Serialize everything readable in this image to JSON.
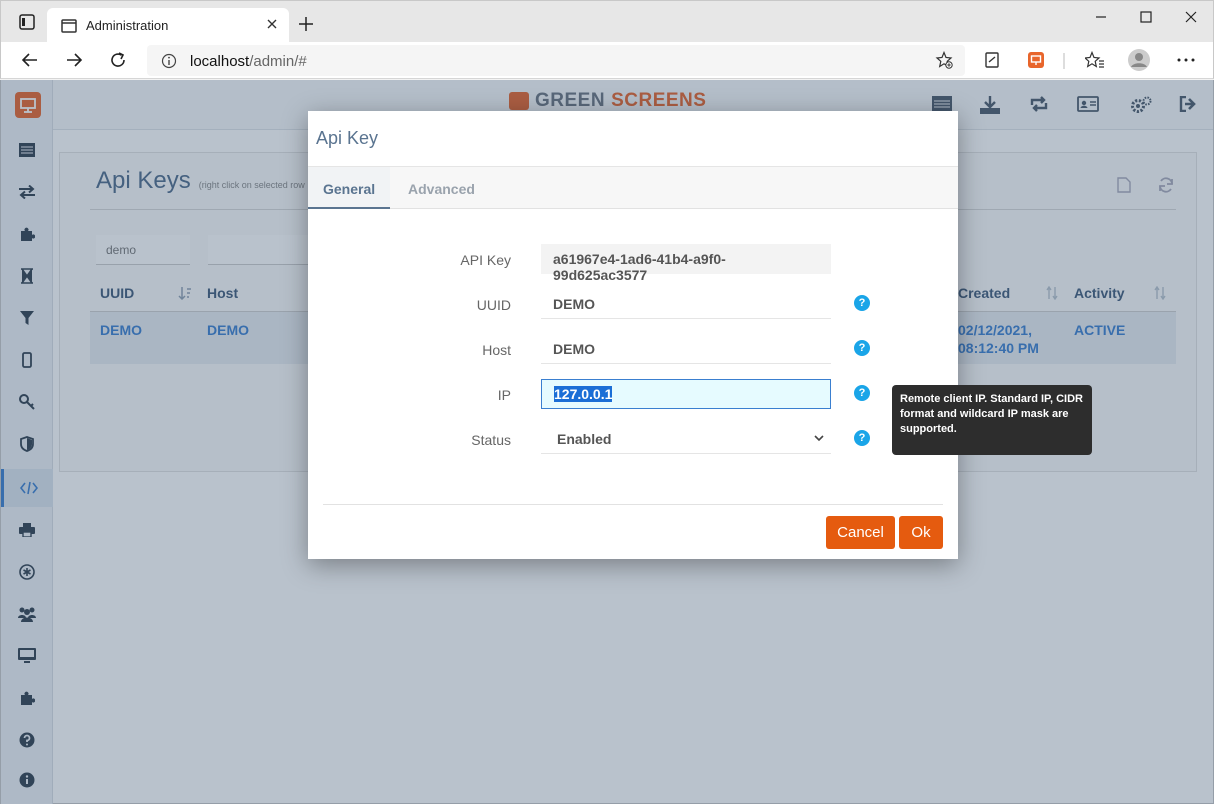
{
  "browser": {
    "tab_title": "Administration",
    "url_host": "localhost",
    "url_path": "/admin/#"
  },
  "brand": {
    "part1": "GREEN",
    "part2": "SCREENS"
  },
  "page": {
    "title": "Api Keys",
    "hint": "(right click on selected row",
    "filter_uuid": "demo",
    "columns": [
      "UUID",
      "Host",
      "Created",
      "Activity"
    ],
    "row": {
      "uuid": "DEMO",
      "host": "DEMO",
      "created_line1": "02/12/2021,",
      "created_line2": "08:12:40 PM",
      "activity": "ACTIVE"
    }
  },
  "modal": {
    "title": "Api Key",
    "tabs": [
      "General",
      "Advanced"
    ],
    "fields": {
      "api_key": {
        "label": "API Key",
        "value": "a61967e4-1ad6-41b4-a9f0-99d625ac3577"
      },
      "uuid": {
        "label": "UUID",
        "value": "DEMO"
      },
      "host": {
        "label": "Host",
        "value": "DEMO"
      },
      "ip": {
        "label": "IP",
        "value": "127.0.0.1"
      },
      "status": {
        "label": "Status",
        "value": "Enabled"
      }
    },
    "help_glyph": "?",
    "cancel_label": "Cancel",
    "ok_label": "Ok"
  },
  "tooltip": {
    "text": "Remote client IP. Standard IP, CIDR format and wildcard IP mask are supported."
  },
  "colors": {
    "accent": "#e55b0f",
    "link": "#3a7fd0",
    "help": "#1aa5e8"
  }
}
